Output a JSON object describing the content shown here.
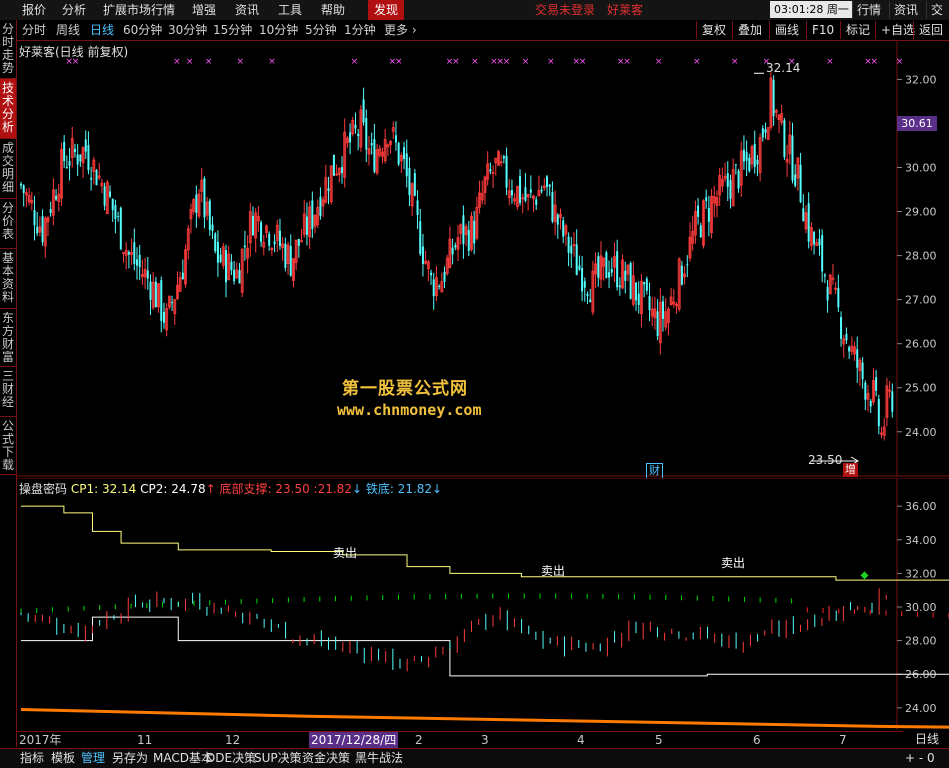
{
  "menu": {
    "items": [
      "报价",
      "分析",
      "扩展市场行情",
      "增强",
      "资讯",
      "工具",
      "帮助"
    ],
    "active": "发现",
    "status_text": "交易未登录",
    "stock_name": "好莱客",
    "clock": "03:01:28 周一",
    "right_buttons": [
      "行情",
      "资讯",
      "交易"
    ]
  },
  "periods": [
    "分时",
    "周线",
    "日线",
    "60分钟",
    "30分钟",
    "15分钟",
    "10分钟",
    "5分钟",
    "1分钟",
    "更多 ›"
  ],
  "selected_period": "日线",
  "tools": [
    "复权",
    "叠加",
    "画线",
    "F10",
    "标记",
    "+自选",
    "返回"
  ],
  "left_tabs": [
    "分时走势",
    "技术分析",
    "成交明细",
    "分价表",
    "基本资料",
    "东方财富",
    "三财经",
    "公式下载"
  ],
  "selected_left_tab": "技术分析",
  "main": {
    "title": "好莱客(日线 前复权)",
    "high_label": "32.14",
    "low_label": "23.50",
    "current_price": "30.61",
    "event_tags": [
      {
        "text": "财",
        "color": "#4fc3ff"
      },
      {
        "text": "增",
        "color": "#ffffff"
      }
    ],
    "watermark_line1": "第一股票公式网",
    "watermark_line2": "www.chnmoney.com"
  },
  "indicator": {
    "name": "操盘密码",
    "cp1_label": "CP1: 32.14",
    "cp2_label": "CP2: 24.78",
    "support_label": "底部支撑: 23.50 ",
    "support_value": "21.82",
    "iron_label": "铁底: 21.82",
    "signals": [
      "卖出",
      "卖出",
      "卖出"
    ]
  },
  "time_axis": {
    "labels": [
      "2017年",
      "11",
      "12",
      "2017/12/28/四",
      "2",
      "3",
      "4",
      "5",
      "6",
      "7"
    ],
    "cursor_label": "2017/12/28/四",
    "period_indicator": "日线"
  },
  "bottom_tabs": [
    "指标",
    "模板",
    "管理",
    "另存为",
    "MACD基本",
    "DDE决策",
    "SUP决策",
    "资金决策",
    "黑牛战法"
  ],
  "selected_bottom_tab": "管理",
  "bottom_right": "+  -  0",
  "colors": {
    "up": "#ff3c3c",
    "down": "#54ffff",
    "frame": "#7a1010",
    "accent": "#b01010",
    "cp1": "#ffff80",
    "cp2": "#ffffff",
    "ma_green": "#00dd00",
    "ma_red": "#ff2020",
    "orange": "#ff7a00",
    "marker": "#ff55ff"
  },
  "chart_data": [
    {
      "type": "candlestick",
      "title": "好莱客(日线 前复权)",
      "ylim": [
        23.2,
        32.6
      ],
      "yticks": [
        24.0,
        25.0,
        26.0,
        27.0,
        28.0,
        29.0,
        30.0,
        31.0,
        32.0
      ],
      "x_labels": [
        "2017年",
        "11",
        "12",
        "2017/12/28/四",
        "2",
        "3",
        "4",
        "5",
        "6",
        "7"
      ],
      "annotations": {
        "high": 32.14,
        "low": 23.5
      },
      "close_path": [
        {
          "i": 0,
          "v": 29.6
        },
        {
          "i": 8,
          "v": 28.6
        },
        {
          "i": 16,
          "v": 30.2
        },
        {
          "i": 24,
          "v": 30.4
        },
        {
          "i": 32,
          "v": 29.4
        },
        {
          "i": 40,
          "v": 28.0
        },
        {
          "i": 48,
          "v": 27.4
        },
        {
          "i": 54,
          "v": 26.5
        },
        {
          "i": 60,
          "v": 27.8
        },
        {
          "i": 66,
          "v": 29.6
        },
        {
          "i": 72,
          "v": 28.0
        },
        {
          "i": 80,
          "v": 27.6
        },
        {
          "i": 86,
          "v": 28.9
        },
        {
          "i": 92,
          "v": 28.6
        },
        {
          "i": 100,
          "v": 27.9
        },
        {
          "i": 108,
          "v": 28.9
        },
        {
          "i": 114,
          "v": 29.8
        },
        {
          "i": 120,
          "v": 30.4
        },
        {
          "i": 126,
          "v": 30.9
        },
        {
          "i": 130,
          "v": 30.2
        },
        {
          "i": 136,
          "v": 30.9
        },
        {
          "i": 142,
          "v": 30.0
        },
        {
          "i": 148,
          "v": 28.4
        },
        {
          "i": 152,
          "v": 27.4
        },
        {
          "i": 156,
          "v": 27.5
        },
        {
          "i": 162,
          "v": 28.4
        },
        {
          "i": 168,
          "v": 28.6
        },
        {
          "i": 172,
          "v": 29.6
        },
        {
          "i": 176,
          "v": 30.0
        },
        {
          "i": 182,
          "v": 29.6
        },
        {
          "i": 188,
          "v": 29.2
        },
        {
          "i": 194,
          "v": 29.6
        },
        {
          "i": 200,
          "v": 28.6
        },
        {
          "i": 206,
          "v": 27.8
        },
        {
          "i": 212,
          "v": 27.3
        },
        {
          "i": 218,
          "v": 27.8
        },
        {
          "i": 224,
          "v": 27.5
        },
        {
          "i": 230,
          "v": 27.0
        },
        {
          "i": 236,
          "v": 26.5
        },
        {
          "i": 240,
          "v": 26.8
        },
        {
          "i": 244,
          "v": 27.5
        },
        {
          "i": 250,
          "v": 28.6
        },
        {
          "i": 256,
          "v": 29.2
        },
        {
          "i": 262,
          "v": 29.6
        },
        {
          "i": 268,
          "v": 30.0
        },
        {
          "i": 274,
          "v": 30.6
        },
        {
          "i": 278,
          "v": 31.6
        },
        {
          "i": 282,
          "v": 30.8
        },
        {
          "i": 288,
          "v": 29.8
        },
        {
          "i": 292,
          "v": 28.6
        },
        {
          "i": 298,
          "v": 27.6
        },
        {
          "i": 304,
          "v": 26.5
        },
        {
          "i": 308,
          "v": 25.8
        },
        {
          "i": 312,
          "v": 25.2
        },
        {
          "i": 316,
          "v": 24.8
        },
        {
          "i": 319,
          "v": 23.9
        },
        {
          "i": 321,
          "v": 24.6
        },
        {
          "i": 323,
          "v": 24.8
        }
      ],
      "marker_positions": [
        7,
        8,
        24,
        26,
        29,
        34,
        39,
        52,
        58,
        59,
        67,
        68,
        71,
        74,
        75,
        76,
        79,
        83,
        87,
        88,
        94,
        95,
        100,
        106,
        112,
        117,
        121,
        127,
        133,
        134,
        138
      ]
    },
    {
      "type": "line",
      "title": "操盘密码",
      "ylim": [
        22.8,
        37.2
      ],
      "yticks": [
        24.0,
        26.0,
        28.0,
        30.0,
        32.0,
        34.0,
        36.0
      ],
      "series": [
        {
          "name": "CP1",
          "color": "#ffff80",
          "step": [
            {
              "x": 0,
              "y": 36.0
            },
            {
              "x": 6,
              "y": 35.6
            },
            {
              "x": 10,
              "y": 34.5
            },
            {
              "x": 14,
              "y": 33.8
            },
            {
              "x": 22,
              "y": 33.4
            },
            {
              "x": 35,
              "y": 33.3
            },
            {
              "x": 45,
              "y": 33.1
            },
            {
              "x": 54,
              "y": 32.4
            },
            {
              "x": 60,
              "y": 32.0
            },
            {
              "x": 70,
              "y": 31.8
            },
            {
              "x": 102,
              "y": 31.8
            },
            {
              "x": 114,
              "y": 31.6
            },
            {
              "x": 130,
              "y": 31.7
            },
            {
              "x": 134,
              "y": 31.4
            },
            {
              "x": 190,
              "y": 31.4
            },
            {
              "x": 218,
              "y": 31.4
            },
            {
              "x": 265,
              "y": 31.6
            },
            {
              "x": 276,
              "y": 32.1
            },
            {
              "x": 330,
              "y": 32.1
            }
          ]
        },
        {
          "name": "CP2",
          "color": "#ffffff",
          "step": [
            {
              "x": 0,
              "y": 28.0
            },
            {
              "x": 10,
              "y": 29.4
            },
            {
              "x": 22,
              "y": 28.0
            },
            {
              "x": 44,
              "y": 28.0
            },
            {
              "x": 60,
              "y": 25.9
            },
            {
              "x": 96,
              "y": 26.0
            },
            {
              "x": 130,
              "y": 25.9
            },
            {
              "x": 166,
              "y": 26.3
            },
            {
              "x": 188,
              "y": 26.1
            },
            {
              "x": 226,
              "y": 26.1
            },
            {
              "x": 236,
              "y": 25.9
            },
            {
              "x": 290,
              "y": 26.0
            },
            {
              "x": 304,
              "y": 25.8
            },
            {
              "x": 314,
              "y": 24.6
            },
            {
              "x": 318,
              "y": 23.6
            },
            {
              "x": 323,
              "y": 23.6
            }
          ]
        },
        {
          "name": "ORANGE",
          "color": "#ff7a00",
          "values": [
            {
              "x": 0,
              "y": 23.9
            },
            {
              "x": 40,
              "y": 23.5
            },
            {
              "x": 80,
              "y": 23.2
            },
            {
              "x": 120,
              "y": 22.9
            },
            {
              "x": 160,
              "y": 22.7
            },
            {
              "x": 200,
              "y": 22.4
            },
            {
              "x": 240,
              "y": 22.2
            },
            {
              "x": 280,
              "y": 22.0
            },
            {
              "x": 310,
              "y": 21.9
            },
            {
              "x": 323,
              "y": 21.8
            }
          ]
        }
      ],
      "signals": [
        {
          "x": 118,
          "y": 32.0,
          "text": "卖出"
        },
        {
          "x": 188,
          "y": 31.4,
          "text": "卖出"
        },
        {
          "x": 259,
          "y": 31.6,
          "text": "卖出"
        }
      ]
    }
  ]
}
